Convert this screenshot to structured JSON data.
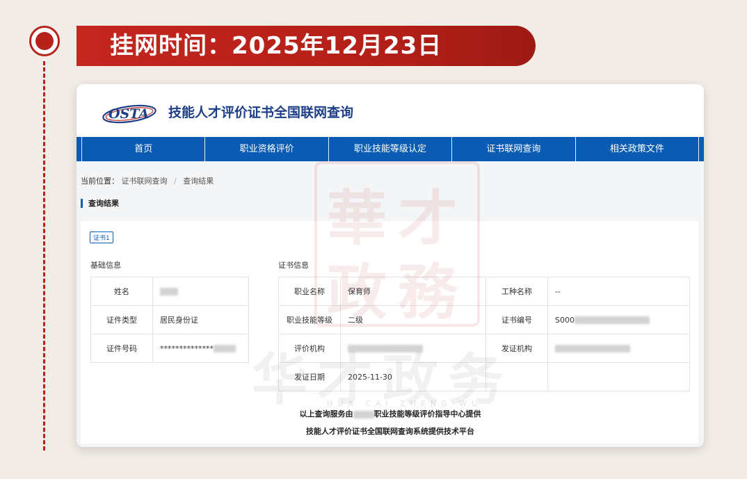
{
  "banner": {
    "date_text": "挂网时间：2025年12月23日"
  },
  "site": {
    "logo_text": "OSTA",
    "title": "技能人才评价证书全国联网查询"
  },
  "nav": {
    "items": [
      "首页",
      "职业资格评价",
      "职业技能等级认定",
      "证书联网查询",
      "相关政策文件"
    ]
  },
  "breadcrumb": {
    "prefix": "当前位置：",
    "items": [
      "证书联网查询",
      "查询结果"
    ]
  },
  "section": {
    "title": "查询结果"
  },
  "cert_tab": "证书1",
  "basic_info": {
    "label": "基础信息",
    "rows": [
      {
        "label": "姓名",
        "value": ""
      },
      {
        "label": "证件类型",
        "value": "居民身份证"
      },
      {
        "label": "证件号码",
        "value": "**************"
      }
    ]
  },
  "cert_info": {
    "label": "证书信息",
    "rows": [
      {
        "label1": "职业名称",
        "value1": "保育师",
        "label2": "工种名称",
        "value2": "--"
      },
      {
        "label1": "职业技能等级",
        "value1": "二级",
        "label2": "证书编号",
        "value2": "S000"
      },
      {
        "label1": "评价机构",
        "value1": "",
        "label2": "发证机构",
        "value2": ""
      },
      {
        "label1": "发证日期",
        "value1": "2025-11-30",
        "label2": "",
        "value2": ""
      }
    ]
  },
  "footer": {
    "line1_prefix": "以上查询服务由",
    "line1_suffix": "职业技能等级评价指导中心提供",
    "line2": "技能人才评价证书全国联网查询系统提供技术平台"
  },
  "watermark": {
    "seal_chars": [
      "華",
      "才",
      "政",
      "務"
    ],
    "text": "华才政务",
    "pinyin": "HUA CAI ZHENG WU"
  },
  "colors": {
    "accent_red": "#b7221b",
    "nav_blue": "#0a5bb3",
    "title_blue": "#1d3f87"
  }
}
